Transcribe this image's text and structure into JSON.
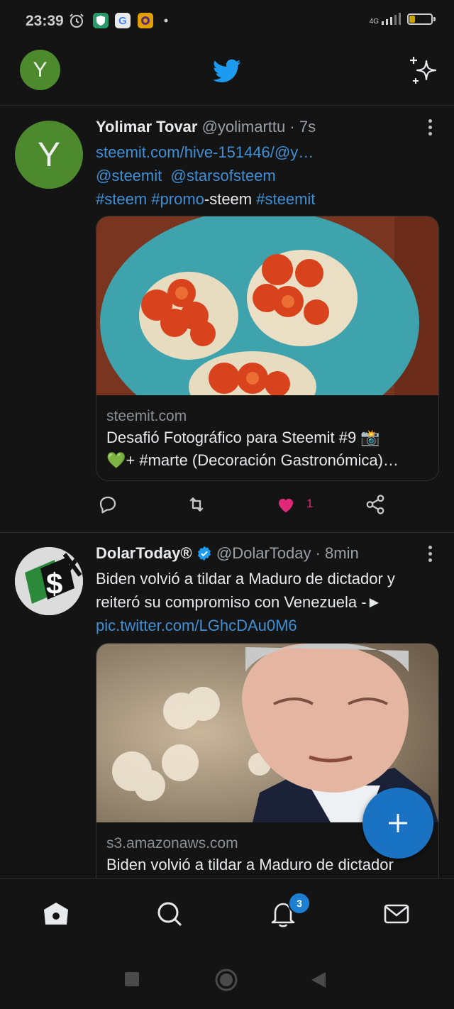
{
  "status_bar": {
    "time": "23:39",
    "network": "4G",
    "battery": "27",
    "battery_level": 0.27
  },
  "header": {
    "avatar_letter": "Y",
    "logo_icon": "twitter-bird-icon",
    "sparkle_icon": "sparkle-icon"
  },
  "tweets": [
    {
      "avatar_letter": "Y",
      "name": "Yolimar Tovar",
      "handle": "@yolimarttu",
      "time": "· 7s",
      "link1": "steemit.com/hive-151446/@y…",
      "mention1": "@steemit",
      "mention2": "@starsofsteem",
      "tag1": "#steem",
      "tag2": "#promo",
      "tag2_suffix": "-steem",
      "tag3": "#steemit",
      "card_domain": "steemit.com",
      "card_title_1": "Desafió Fotográfico para Steemit #9 📸",
      "card_title_2": "💚+ #marte (Decoración Gastronómica)…",
      "like_count": "1"
    },
    {
      "name": "DolarToday®",
      "handle": "@DolarToday",
      "time": "· 8min",
      "text": "Biden volvió a tildar a Maduro de dictador y reiteró su compromiso con Venezuela -►",
      "link": "pic.twitter.com/LGhcDAu0M6",
      "card_domain": "s3.amazonaws.com",
      "card_title": "Biden volvió a tildar a Maduro de dictador"
    }
  ],
  "bottom_nav": {
    "notifications_badge": "3"
  },
  "colors": {
    "accent": "#1d9bf0",
    "link": "#3e8fd6",
    "like": "#e0287a",
    "avatar_green": "#4d8a2e"
  }
}
